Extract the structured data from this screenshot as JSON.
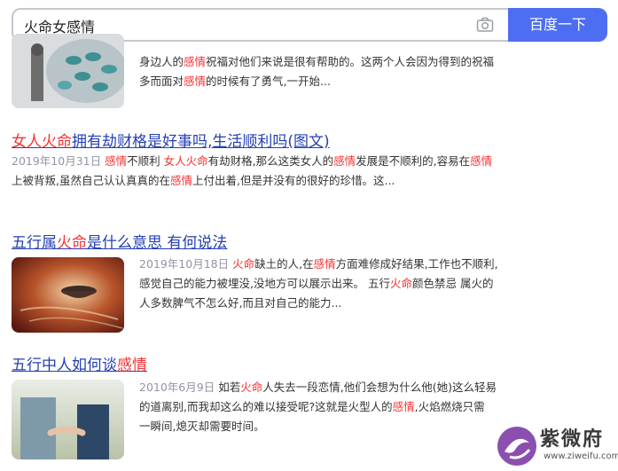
{
  "search": {
    "query": "火命女感情",
    "button_label": "百度一下"
  },
  "result0": {
    "lines": [
      [
        {
          "t": "身边人的"
        },
        {
          "t": "感情",
          "h": 1
        },
        {
          "t": "祝福对他们来说是很有帮助的。这两个人会因为得到的祝福"
        }
      ],
      [
        {
          "t": "多而面对"
        },
        {
          "t": "感情",
          "h": 1
        },
        {
          "t": "的时候有了勇气,一开始..."
        }
      ]
    ]
  },
  "result1": {
    "title": [
      {
        "t": "女人火命",
        "h": 1
      },
      {
        "t": "拥有劫财格是好事吗,生活顺利吗(图文)"
      }
    ],
    "date": "2019年10月31日",
    "lines": [
      [
        {
          "t": " "
        },
        {
          "t": "感情",
          "h": 1
        },
        {
          "t": "不顺利 "
        },
        {
          "t": "女人火命",
          "h": 1
        },
        {
          "t": "有劫财格,那么这类女人的"
        },
        {
          "t": "感情",
          "h": 1
        },
        {
          "t": "发展是不顺利的,容易在"
        },
        {
          "t": "感情",
          "h": 1
        }
      ],
      [
        {
          "t": "上被背叛,虽然自己认认真真的在"
        },
        {
          "t": "感情",
          "h": 1
        },
        {
          "t": "上付出着,但是并没有的很好的珍惜。这..."
        }
      ]
    ]
  },
  "result2": {
    "title": [
      {
        "t": "五行属"
      },
      {
        "t": "火命",
        "h": 1
      },
      {
        "t": "是什么意思 有何说法"
      }
    ],
    "date": "2019年10月18日",
    "lines": [
      [
        {
          "t": " "
        },
        {
          "t": "火命",
          "h": 1
        },
        {
          "t": "缺土的人,在"
        },
        {
          "t": "感情",
          "h": 1
        },
        {
          "t": "方面难修成好结果,工作也不顺利,"
        }
      ],
      [
        {
          "t": "感觉自己的能力被埋没,没地方可以展示出来。 五行"
        },
        {
          "t": "火命",
          "h": 1
        },
        {
          "t": "颜色禁忌 属火的"
        }
      ],
      [
        {
          "t": "人多数脾气不怎么好,而且对自己的能力..."
        }
      ]
    ]
  },
  "result3": {
    "title": [
      {
        "t": "五行中人如何谈"
      },
      {
        "t": "感情",
        "h": 1
      }
    ],
    "date": "2010年6月9日",
    "lines": [
      [
        {
          "t": " 如若"
        },
        {
          "t": "火命",
          "h": 1
        },
        {
          "t": "人失去一段恋情,他们会想为什么他(她)这么轻易"
        }
      ],
      [
        {
          "t": "的道离别,而我却这么的难以接受呢?这就是火型人的"
        },
        {
          "t": "感情",
          "h": 1
        },
        {
          "t": ",火焰燃烧只需"
        }
      ],
      [
        {
          "t": "一瞬间,熄灭却需要时间。"
        }
      ]
    ]
  },
  "watermark": {
    "name": "紫微府",
    "url": "www.ziweifu.com"
  }
}
